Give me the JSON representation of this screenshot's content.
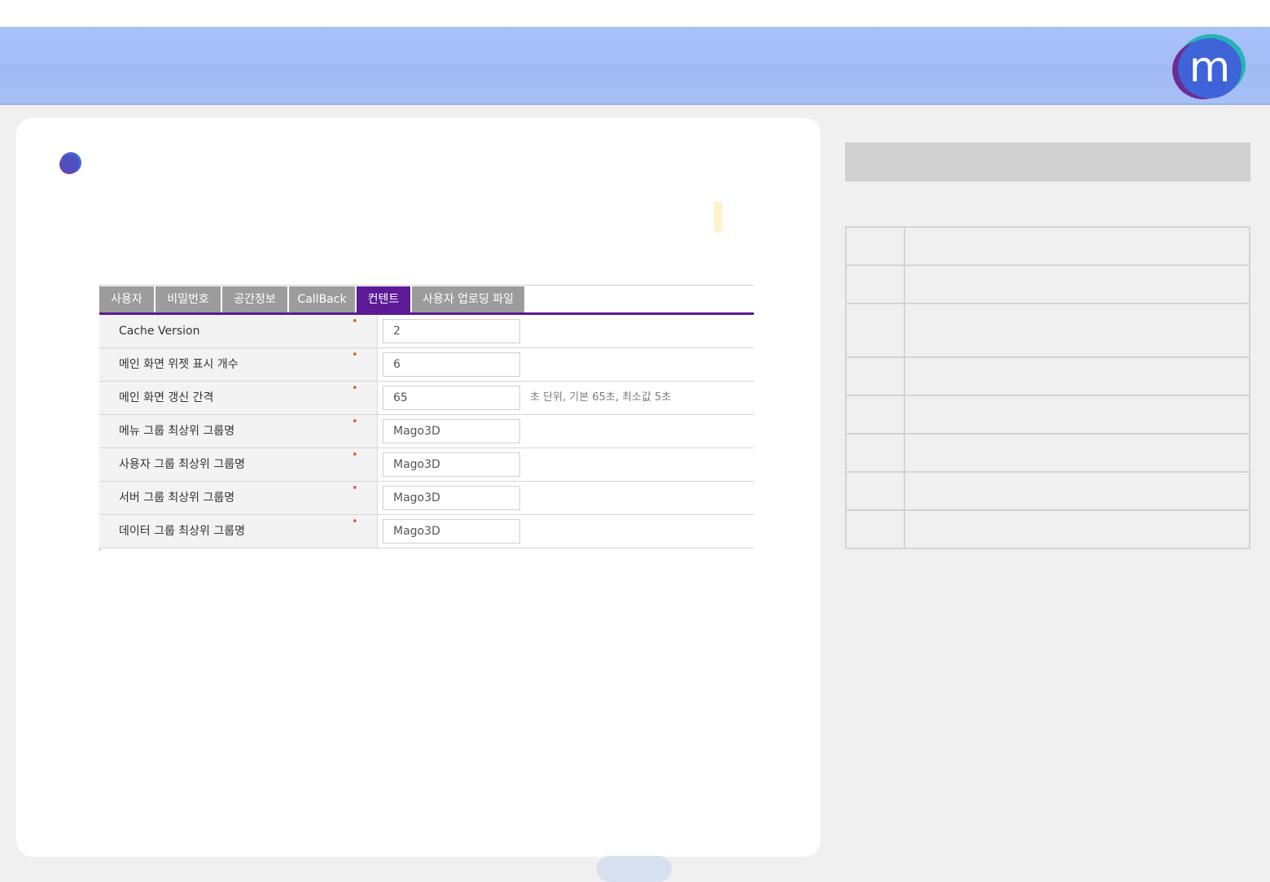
{
  "brand": {
    "logo_letter": "m",
    "colors": {
      "purple": "#5c1a96",
      "teal": "#1e9ea8",
      "blue": "#3a5fd8",
      "header": "#a6bff6"
    }
  },
  "tabs": [
    {
      "label": "사용자",
      "active": false
    },
    {
      "label": "비밀번호",
      "active": false
    },
    {
      "label": "공간정보",
      "active": false
    },
    {
      "label": "CallBack",
      "active": false
    },
    {
      "label": "컨텐트",
      "active": true
    },
    {
      "label": "사용자 업로딩 파일",
      "active": false
    }
  ],
  "form": {
    "rows": [
      {
        "label": "Cache Version",
        "required_mark": "•",
        "value": "2",
        "hint": ""
      },
      {
        "label": "메인 화면 위젯 표시 개수",
        "required_mark": "•",
        "value": "6",
        "hint": ""
      },
      {
        "label": "메인 화면 갱신 간격",
        "required_mark": "•",
        "value": "65",
        "hint": "초 단위, 기본 65초, 최소값 5초"
      },
      {
        "label": "메뉴 그룹 최상위 그룹명",
        "required_mark": "•",
        "value": "Mago3D",
        "hint": ""
      },
      {
        "label": "사용자 그룹 최상위 그룹명",
        "required_mark": "•",
        "value": "Mago3D",
        "hint": ""
      },
      {
        "label": "서버 그룹 최상위 그룹명",
        "required_mark": "•",
        "value": "Mago3D",
        "hint": ""
      },
      {
        "label": "데이터 그룹 최상위 그룹명",
        "required_mark": "•",
        "value": "Mago3D",
        "hint": ""
      }
    ]
  }
}
